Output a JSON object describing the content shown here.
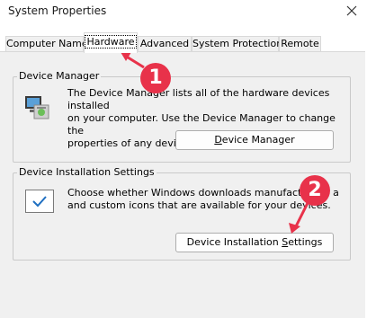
{
  "window": {
    "title": "System Properties",
    "close_icon": "close-icon"
  },
  "tabs": [
    {
      "label": "Computer Name",
      "active": false
    },
    {
      "label": "Hardware",
      "active": true
    },
    {
      "label": "Advanced",
      "active": false
    },
    {
      "label": "System Protection",
      "active": false
    },
    {
      "label": "Remote",
      "active": false
    }
  ],
  "device_manager": {
    "group_label": "Device Manager",
    "description_lines": [
      "The Device Manager lists all of the hardware devices installed",
      "on your computer. Use the Device Manager to change the",
      "properties of any device."
    ],
    "button_label": "Device Manager",
    "icon": "device-manager-icon"
  },
  "device_installation": {
    "group_label": "Device Installation Settings",
    "description_lines": [
      "Choose whether Windows downloads manufacturers' a",
      "and custom icons that are available for your devices."
    ],
    "button_label": "Device Installation Settings",
    "icon": "checkmark-icon"
  },
  "annotations": [
    {
      "number": "1",
      "color": "#e8324a"
    },
    {
      "number": "2",
      "color": "#e8324a"
    }
  ]
}
